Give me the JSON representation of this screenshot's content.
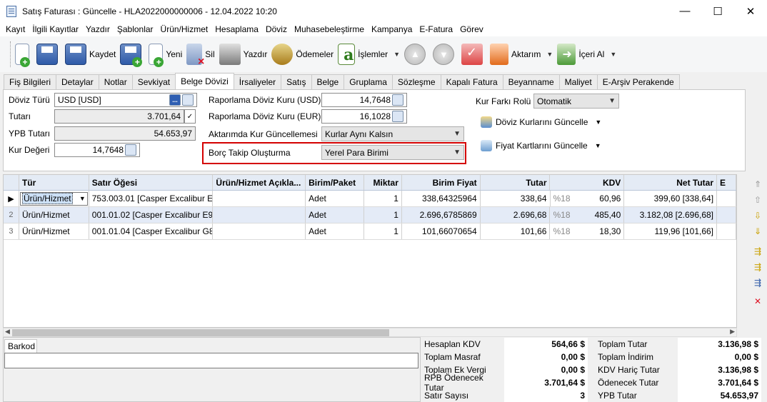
{
  "window": {
    "title": "Satış Faturası : Güncelle - HLA2022000000006 - 12.04.2022 10:20",
    "minimize": "—",
    "maximize": "☐",
    "close": "✕"
  },
  "menu": [
    "Kayıt",
    "İlgili Kayıtlar",
    "Yazdır",
    "Şablonlar",
    "Ürün/Hizmet",
    "Hesaplama",
    "Döviz",
    "Muhasebeleştirme",
    "Kampanya",
    "E-Fatura",
    "Görev"
  ],
  "toolbar": {
    "kaydet": "Kaydet",
    "yeni": "Yeni",
    "sil": "Sil",
    "yazdir": "Yazdır",
    "odemeler": "Ödemeler",
    "islemler": "İşlemler",
    "aktarim": "Aktarım",
    "iceri_al": "İçeri Al",
    "dropdown": "▼"
  },
  "tabs": [
    "Fiş Bilgileri",
    "Detaylar",
    "Notlar",
    "Sevkiyat",
    "Belge Dövizi",
    "İrsaliyeler",
    "Satış",
    "Belge",
    "Gruplama",
    "Sözleşme",
    "Kapalı Fatura",
    "Beyanname",
    "Maliyet",
    "E-Arşiv Perakende"
  ],
  "active_tab": "Belge Dövizi",
  "form": {
    "doviz_turu_label": "Döviz Türü",
    "doviz_turu": "USD [USD]",
    "ellipsis": "...",
    "tutari_label": "Tutarı",
    "tutari": "3.701,64",
    "ypb_tutari_label": "YPB Tutarı",
    "ypb_tutari": "54.653,97",
    "kur_degeri_label": "Kur Değeri",
    "kur_degeri": "14,7648",
    "rap_usd_label": "Raporlama Döviz Kuru (USD)",
    "rap_usd": "14,7648",
    "rap_eur_label": "Raporlama Döviz Kuru (EUR)",
    "rap_eur": "16,1028",
    "aktarim_kur_label": "Aktarımda Kur Güncellemesi",
    "aktarim_kur": "Kurlar Aynı Kalsın",
    "borc_takip_label": "Borç Takip Oluşturma",
    "borc_takip": "Yerel Para Birimi",
    "kur_farki_label": "Kur Farkı Rolü",
    "kur_farki": "Otomatik",
    "doviz_guncelle": "Döviz Kurlarını Güncelle",
    "fiyat_guncelle": "Fiyat Kartlarını Güncelle"
  },
  "grid": {
    "columns": [
      "Tür",
      "Satır Öğesi",
      "Ürün/Hizmet Açıkla...",
      "Birim/Paket",
      "Miktar",
      "Birim Fiyat",
      "Tutar",
      "KDV",
      "Net Tutar",
      "E"
    ],
    "rows": [
      {
        "ind": "▶",
        "tur": "Ürün/Hizmet",
        "oge": "753.003.01 [Casper Excalibur E...",
        "aciklama": "",
        "birim": "Adet",
        "miktar": "1",
        "birim_fiyat": "338,64325964",
        "tutar": "338,64",
        "kdv_oran": "%18",
        "kdv": "60,96",
        "net": "399,60 [338,64]"
      },
      {
        "ind": "2",
        "tur": "Ürün/Hizmet",
        "oge": "001.01.02 [Casper Excalibur E9...",
        "aciklama": "",
        "birim": "Adet",
        "miktar": "1",
        "birim_fiyat": "2.696,6785869",
        "tutar": "2.696,68",
        "kdv_oran": "%18",
        "kdv": "485,40",
        "net": "3.182,08 [2.696,68]"
      },
      {
        "ind": "3",
        "tur": "Ürün/Hizmet",
        "oge": "001.01.04 [Casper Excalibur G8...",
        "aciklama": "",
        "birim": "Adet",
        "miktar": "1",
        "birim_fiyat": "101,66070654",
        "tutar": "101,66",
        "kdv_oran": "%18",
        "kdv": "18,30",
        "net": "119,96 [101,66]"
      }
    ]
  },
  "barkod_label": "Barkod",
  "totals": {
    "hesaplan_kdv_label": "Hesaplan KDV",
    "hesaplan_kdv": "564,66 $",
    "toplam_masraf_label": "Toplam Masraf",
    "toplam_masraf": "0,00 $",
    "toplam_ek_vergi_label": "Toplam Ek Vergi",
    "toplam_ek_vergi": "0,00 $",
    "rpb_odenecek_label": "RPB Ödenecek Tutar",
    "rpb_odenecek": "3.701,64 $",
    "satir_sayisi_label": "Satır Sayısı",
    "satir_sayisi": "3",
    "toplam_tutar_label": "Toplam Tutar",
    "toplam_tutar": "3.136,98 $",
    "toplam_indirim_label": "Toplam İndirim",
    "toplam_indirim": "0,00 $",
    "kdv_haric_label": "KDV Hariç Tutar",
    "kdv_haric": "3.136,98 $",
    "odenecek_label": "Ödenecek Tutar",
    "odenecek": "3.701,64 $",
    "ypb_tutar_label": "YPB Tutar",
    "ypb_tutar": "54.653,97"
  }
}
